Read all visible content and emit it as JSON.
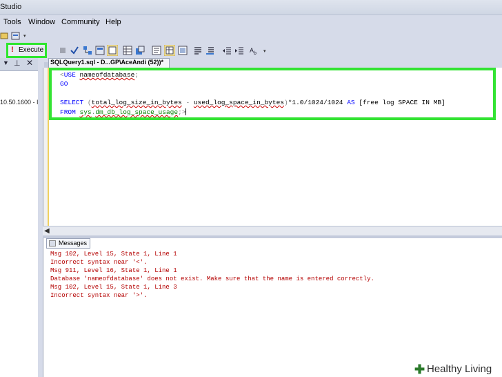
{
  "window": {
    "title": "Studio"
  },
  "menu": {
    "items": [
      "Tools",
      "Window",
      "Community",
      "Help"
    ]
  },
  "toolbar": {
    "execute_label": "Execute",
    "execute_mark": "!"
  },
  "object_explorer": {
    "node_text": "10.50.1600 - I"
  },
  "document_tab": {
    "title": "SQLQuery1.sql - D...GP\\AceAndi (52))*"
  },
  "editor": {
    "line1": {
      "kw": "USE",
      "name": "nameofdatabase",
      "end": ";"
    },
    "line2": {
      "kw": "GO"
    },
    "line4": {
      "kw": "SELECT",
      "open": "(",
      "col1": "total_log_size_in_bytes",
      "minus": " - ",
      "col2": "used_log_space_in_bytes",
      "close": ")",
      "calc": "*1.0/1024/1024",
      "as": "AS",
      "alias": "[free log SPACE IN MB]"
    },
    "line5": {
      "kw": "FROM",
      "schema": "sys",
      "dot": ".",
      "view": "dm_db_log_space_usage",
      "end": ";"
    }
  },
  "messages": {
    "tab_label": "Messages",
    "lines": [
      "Msg 102, Level 15, State 1, Line 1",
      "Incorrect syntax near '<'.",
      "Msg 911, Level 16, State 1, Line 1",
      "Database 'nameofdatabase' does not exist. Make sure that the name is entered correctly.",
      "Msg 102, Level 15, State 1, Line 3",
      "Incorrect syntax near '>'."
    ]
  },
  "watermark": {
    "brand": "Healthy Living"
  },
  "colors": {
    "highlight": "#33e333",
    "error_text": "#b40000",
    "keyword": "#0000ff"
  }
}
